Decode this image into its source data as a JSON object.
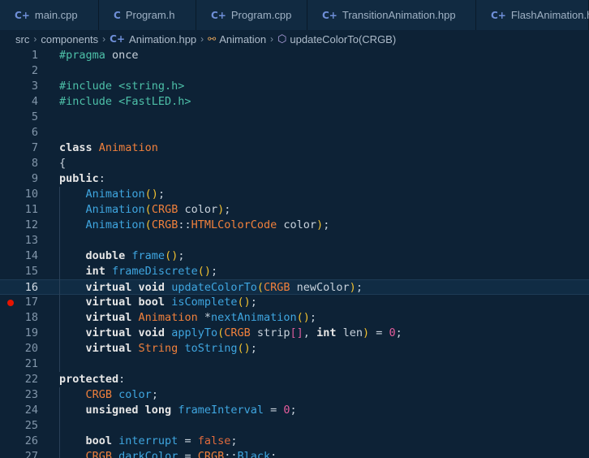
{
  "tabs": [
    {
      "icon": "C+",
      "label": "main.cpp"
    },
    {
      "icon": "C",
      "label": "Program.h"
    },
    {
      "icon": "C+",
      "label": "Program.cpp"
    },
    {
      "icon": "C+",
      "label": "TransitionAnimation.hpp"
    },
    {
      "icon": "C+",
      "label": "FlashAnimation.hpp"
    }
  ],
  "breadcrumb": {
    "part1": "src",
    "part2": "components",
    "file_icon": "C+",
    "file": "Animation.hpp",
    "class": "Animation",
    "method": "updateColorTo(CRGB)"
  },
  "editor": {
    "current_line": 16,
    "breakpoint_line": 17,
    "lines": [
      {
        "n": 1,
        "tokens": [
          [
            "pp",
            "#pragma"
          ],
          [
            "n",
            " once"
          ]
        ]
      },
      {
        "n": 2,
        "tokens": []
      },
      {
        "n": 3,
        "tokens": [
          [
            "pp",
            "#include "
          ],
          [
            "str",
            "<string.h>"
          ]
        ]
      },
      {
        "n": 4,
        "tokens": [
          [
            "pp",
            "#include "
          ],
          [
            "str",
            "<FastLED.h>"
          ]
        ]
      },
      {
        "n": 5,
        "tokens": []
      },
      {
        "n": 6,
        "tokens": []
      },
      {
        "n": 7,
        "tokens": [
          [
            "k",
            "class "
          ],
          [
            "t",
            "Animation"
          ]
        ]
      },
      {
        "n": 8,
        "tokens": [
          [
            "n",
            "{"
          ]
        ]
      },
      {
        "n": 9,
        "tokens": [
          [
            "k",
            "public"
          ],
          [
            "n",
            ":"
          ]
        ]
      },
      {
        "n": 10,
        "tokens": [
          [
            "n",
            "    "
          ],
          [
            "f",
            "Animation"
          ],
          [
            "p",
            "()"
          ],
          [
            "n",
            ";"
          ]
        ]
      },
      {
        "n": 11,
        "tokens": [
          [
            "n",
            "    "
          ],
          [
            "f",
            "Animation"
          ],
          [
            "p",
            "("
          ],
          [
            "t",
            "CRGB"
          ],
          [
            "n",
            " color"
          ],
          [
            "p",
            ")"
          ],
          [
            "n",
            ";"
          ]
        ]
      },
      {
        "n": 12,
        "tokens": [
          [
            "n",
            "    "
          ],
          [
            "f",
            "Animation"
          ],
          [
            "p",
            "("
          ],
          [
            "t",
            "CRGB"
          ],
          [
            "n",
            "::"
          ],
          [
            "t",
            "HTMLColorCode"
          ],
          [
            "n",
            " color"
          ],
          [
            "p",
            ")"
          ],
          [
            "n",
            ";"
          ]
        ]
      },
      {
        "n": 13,
        "tokens": []
      },
      {
        "n": 14,
        "tokens": [
          [
            "n",
            "    "
          ],
          [
            "k",
            "double "
          ],
          [
            "f",
            "frame"
          ],
          [
            "p",
            "()"
          ],
          [
            "n",
            ";"
          ]
        ]
      },
      {
        "n": 15,
        "tokens": [
          [
            "n",
            "    "
          ],
          [
            "k",
            "int "
          ],
          [
            "f",
            "frameDiscrete"
          ],
          [
            "p",
            "()"
          ],
          [
            "n",
            ";"
          ]
        ]
      },
      {
        "n": 16,
        "tokens": [
          [
            "n",
            "    "
          ],
          [
            "k",
            "virtual void "
          ],
          [
            "f",
            "updateColorTo"
          ],
          [
            "p",
            "("
          ],
          [
            "t",
            "CRGB"
          ],
          [
            "n",
            " newColor"
          ],
          [
            "p",
            ")"
          ],
          [
            "n",
            ";"
          ]
        ]
      },
      {
        "n": 17,
        "tokens": [
          [
            "n",
            "    "
          ],
          [
            "k",
            "virtual bool "
          ],
          [
            "f",
            "isComplete"
          ],
          [
            "p",
            "()"
          ],
          [
            "n",
            ";"
          ]
        ]
      },
      {
        "n": 18,
        "tokens": [
          [
            "n",
            "    "
          ],
          [
            "k",
            "virtual "
          ],
          [
            "t",
            "Animation"
          ],
          [
            "n",
            " *"
          ],
          [
            "f",
            "nextAnimation"
          ],
          [
            "p",
            "()"
          ],
          [
            "n",
            ";"
          ]
        ]
      },
      {
        "n": 19,
        "tokens": [
          [
            "n",
            "    "
          ],
          [
            "k",
            "virtual void "
          ],
          [
            "f",
            "applyTo"
          ],
          [
            "p",
            "("
          ],
          [
            "t",
            "CRGB"
          ],
          [
            "n",
            " strip"
          ],
          [
            "br",
            "[]"
          ],
          [
            "n",
            ", "
          ],
          [
            "k",
            "int"
          ],
          [
            "n",
            " len"
          ],
          [
            "p",
            ")"
          ],
          [
            "n",
            " = "
          ],
          [
            "num",
            "0"
          ],
          [
            "n",
            ";"
          ]
        ]
      },
      {
        "n": 20,
        "tokens": [
          [
            "n",
            "    "
          ],
          [
            "k",
            "virtual "
          ],
          [
            "t",
            "String"
          ],
          [
            "n",
            " "
          ],
          [
            "f",
            "toString"
          ],
          [
            "p",
            "()"
          ],
          [
            "n",
            ";"
          ]
        ]
      },
      {
        "n": 21,
        "tokens": []
      },
      {
        "n": 22,
        "tokens": [
          [
            "k",
            "protected"
          ],
          [
            "n",
            ":"
          ]
        ]
      },
      {
        "n": 23,
        "tokens": [
          [
            "n",
            "    "
          ],
          [
            "t",
            "CRGB"
          ],
          [
            "n",
            " "
          ],
          [
            "f",
            "color"
          ],
          [
            "n",
            ";"
          ]
        ]
      },
      {
        "n": 24,
        "tokens": [
          [
            "n",
            "    "
          ],
          [
            "k",
            "unsigned long "
          ],
          [
            "f",
            "frameInterval"
          ],
          [
            "n",
            " = "
          ],
          [
            "num",
            "0"
          ],
          [
            "n",
            ";"
          ]
        ]
      },
      {
        "n": 25,
        "tokens": []
      },
      {
        "n": 26,
        "tokens": [
          [
            "n",
            "    "
          ],
          [
            "k",
            "bool "
          ],
          [
            "f",
            "interrupt"
          ],
          [
            "n",
            " = "
          ],
          [
            "lit",
            "false"
          ],
          [
            "n",
            ";"
          ]
        ]
      },
      {
        "n": 27,
        "tokens": [
          [
            "n",
            "    "
          ],
          [
            "t",
            "CRGB"
          ],
          [
            "n",
            " "
          ],
          [
            "f",
            "darkColor"
          ],
          [
            "n",
            " = "
          ],
          [
            "t",
            "CRGB"
          ],
          [
            "n",
            "::"
          ],
          [
            "f",
            "Black"
          ],
          [
            "n",
            ";"
          ]
        ]
      }
    ]
  }
}
